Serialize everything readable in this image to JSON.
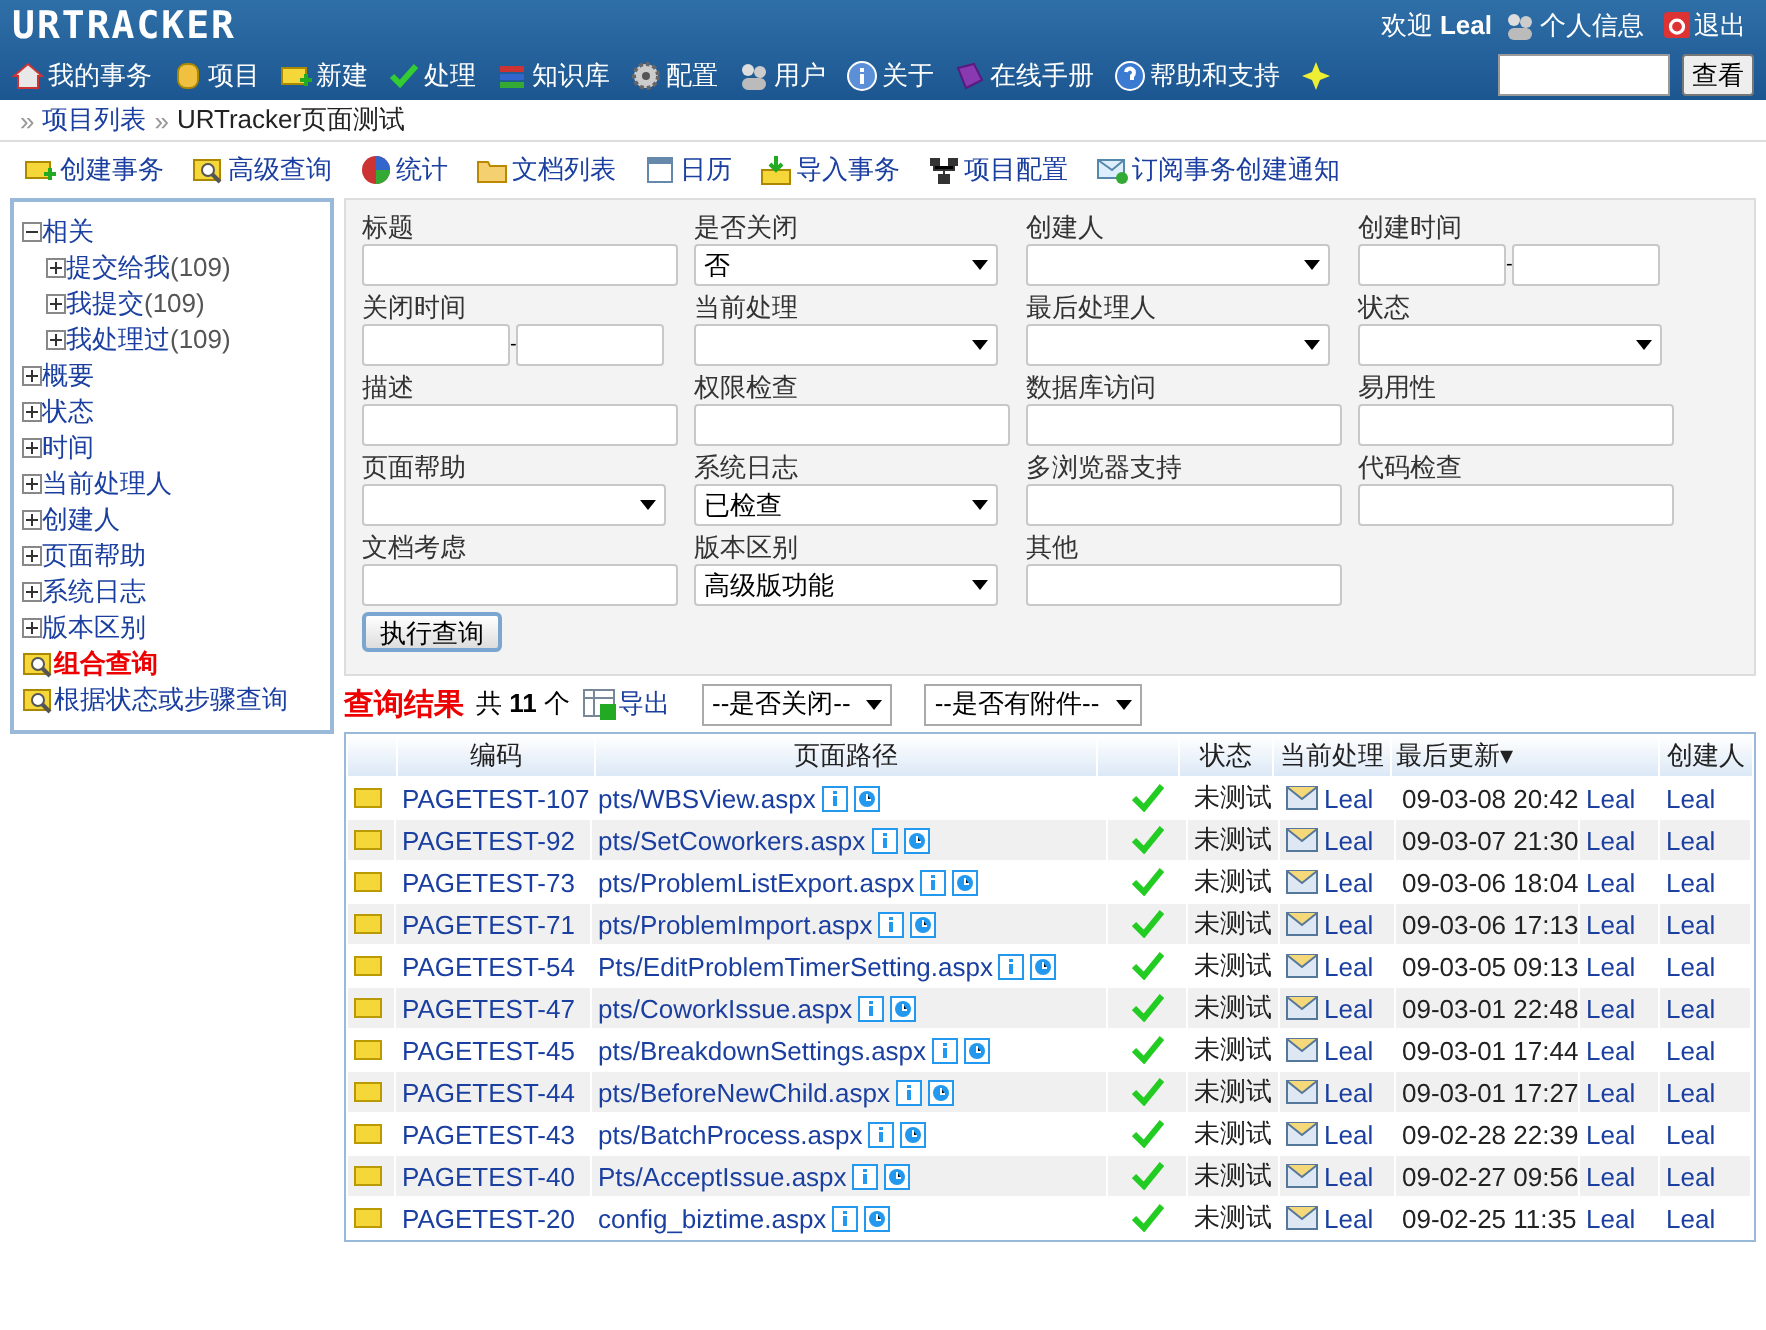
{
  "header": {
    "logo": "URTRACKER",
    "welcome": "欢迎",
    "user": "Leal",
    "profile": "个人信息",
    "logout": "退出",
    "nav": [
      "我的事务",
      "项目",
      "新建",
      "处理",
      "知识库",
      "配置",
      "用户",
      "关于",
      "在线手册",
      "帮助和支持"
    ],
    "search_button": "查看"
  },
  "breadcrumb": [
    {
      "separator": "»",
      "label": "项目列表",
      "link": true
    },
    {
      "separator": "»",
      "label": "URTracker页面测试",
      "link": false
    }
  ],
  "toolbar": [
    "创建事务",
    "高级查询",
    "统计",
    "文档列表",
    "日历",
    "导入事务",
    "项目配置",
    "订阅事务创建通知"
  ],
  "tree": [
    {
      "kind": "folder",
      "label": "相关",
      "expanded": true,
      "children": [
        {
          "kind": "folder",
          "label": "提交给我",
          "count": "(109)",
          "expanded": false
        },
        {
          "kind": "folder",
          "label": "我提交",
          "count": "(109)",
          "expanded": false
        },
        {
          "kind": "folder",
          "label": "我处理过",
          "count": "(109)",
          "expanded": false
        }
      ]
    },
    {
      "kind": "folder",
      "label": "概要",
      "expanded": false
    },
    {
      "kind": "folder",
      "label": "状态",
      "expanded": false
    },
    {
      "kind": "folder",
      "label": "时间",
      "expanded": false
    },
    {
      "kind": "folder",
      "label": "当前处理人",
      "expanded": false
    },
    {
      "kind": "folder",
      "label": "创建人",
      "expanded": false
    },
    {
      "kind": "folder",
      "label": "页面帮助",
      "expanded": false
    },
    {
      "kind": "folder",
      "label": "系统日志",
      "expanded": false
    },
    {
      "kind": "folder",
      "label": "版本区别",
      "expanded": false
    },
    {
      "kind": "query",
      "label": "组合查询",
      "selected": true
    },
    {
      "kind": "query",
      "label": "根据状态或步骤查询",
      "selected": false
    }
  ],
  "form": {
    "fields": [
      {
        "label": "标题",
        "kind": "text"
      },
      {
        "label": "是否关闭",
        "kind": "select",
        "value": "否"
      },
      {
        "label": "创建人",
        "kind": "select"
      },
      {
        "label": "创建时间",
        "kind": "range"
      },
      {
        "label": "关闭时间",
        "kind": "range"
      },
      {
        "label": "当前处理",
        "kind": "select"
      },
      {
        "label": "最后处理人",
        "kind": "select"
      },
      {
        "label": "状态",
        "kind": "select"
      },
      {
        "label": "描述",
        "kind": "text"
      },
      {
        "label": "权限检查",
        "kind": "text"
      },
      {
        "label": "数据库访问",
        "kind": "text"
      },
      {
        "label": "易用性",
        "kind": "text"
      },
      {
        "label": "页面帮助",
        "kind": "select"
      },
      {
        "label": "系统日志",
        "kind": "select",
        "value": "已检查"
      },
      {
        "label": "多浏览器支持",
        "kind": "text"
      },
      {
        "label": "代码检查",
        "kind": "text"
      },
      {
        "label": "文档考虑",
        "kind": "text"
      },
      {
        "label": "版本区别",
        "kind": "select",
        "value": "高级版功能"
      },
      {
        "label": "其他",
        "kind": "text"
      }
    ],
    "range_separator": "-",
    "submit": "执行查询"
  },
  "results": {
    "title": "查询结果",
    "total_prefix": "共",
    "total": "11",
    "total_suffix": "个",
    "export": "导出",
    "filters": [
      "--是否关闭--",
      "--是否有附件--"
    ],
    "columns": [
      "编码",
      "页面路径",
      "状态",
      "当前处理",
      "最后更新▾",
      "创建人"
    ],
    "rows": [
      {
        "code": "PAGETEST-107",
        "path": "pts/WBSView.aspx",
        "status": "未测试",
        "handler": "Leal",
        "updated": "09-03-08 20:42",
        "updated_by": "Leal",
        "creator": "Leal"
      },
      {
        "code": "PAGETEST-92",
        "path": "pts/SetCoworkers.aspx",
        "status": "未测试",
        "handler": "Leal",
        "updated": "09-03-07 21:30",
        "updated_by": "Leal",
        "creator": "Leal"
      },
      {
        "code": "PAGETEST-73",
        "path": "pts/ProblemListExport.aspx",
        "status": "未测试",
        "handler": "Leal",
        "updated": "09-03-06 18:04",
        "updated_by": "Leal",
        "creator": "Leal"
      },
      {
        "code": "PAGETEST-71",
        "path": "pts/ProblemImport.aspx",
        "status": "未测试",
        "handler": "Leal",
        "updated": "09-03-06 17:13",
        "updated_by": "Leal",
        "creator": "Leal"
      },
      {
        "code": "PAGETEST-54",
        "path": "Pts/EditProblemTimerSetting.aspx",
        "status": "未测试",
        "handler": "Leal",
        "updated": "09-03-05 09:13",
        "updated_by": "Leal",
        "creator": "Leal"
      },
      {
        "code": "PAGETEST-47",
        "path": "pts/CoworkIssue.aspx",
        "status": "未测试",
        "handler": "Leal",
        "updated": "09-03-01 22:48",
        "updated_by": "Leal",
        "creator": "Leal"
      },
      {
        "code": "PAGETEST-45",
        "path": "pts/BreakdownSettings.aspx",
        "status": "未测试",
        "handler": "Leal",
        "updated": "09-03-01 17:44",
        "updated_by": "Leal",
        "creator": "Leal"
      },
      {
        "code": "PAGETEST-44",
        "path": "pts/BeforeNewChild.aspx",
        "status": "未测试",
        "handler": "Leal",
        "updated": "09-03-01 17:27",
        "updated_by": "Leal",
        "creator": "Leal"
      },
      {
        "code": "PAGETEST-43",
        "path": "pts/BatchProcess.aspx",
        "status": "未测试",
        "handler": "Leal",
        "updated": "09-02-28 22:39",
        "updated_by": "Leal",
        "creator": "Leal"
      },
      {
        "code": "PAGETEST-40",
        "path": "Pts/AcceptIssue.aspx",
        "status": "未测试",
        "handler": "Leal",
        "updated": "09-02-27 09:56",
        "updated_by": "Leal",
        "creator": "Leal"
      },
      {
        "code": "PAGETEST-20",
        "path": "config_biztime.aspx",
        "status": "未测试",
        "handler": "Leal",
        "updated": "09-02-25 11:35",
        "updated_by": "Leal",
        "creator": "Leal"
      }
    ]
  }
}
